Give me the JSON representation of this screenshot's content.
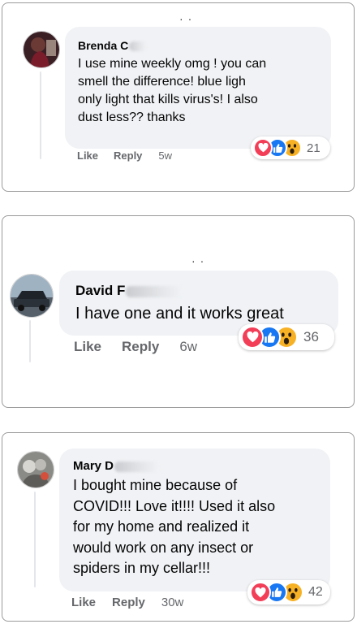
{
  "comments": [
    {
      "author_visible": "Brenda C",
      "text": "I use mine weekly omg ! you can smell the difference! blue ligh only light that kills virus's! I also dust less?? thanks",
      "text_lines": [
        "I use mine weekly omg ! you can",
        "smell the difference! blue ligh",
        "only light that kills virus's! I also",
        "dust less?? thanks"
      ],
      "like_label": "Like",
      "reply_label": "Reply",
      "time": "5w",
      "reaction_count": "21",
      "reaction_icons": [
        "love-icon",
        "like-icon",
        "wow-icon"
      ]
    },
    {
      "author_visible": "David F",
      "text": "I have one and it works great",
      "text_lines": [
        "I have one and it works great"
      ],
      "like_label": "Like",
      "reply_label": "Reply",
      "time": "6w",
      "reaction_count": "36",
      "reaction_icons": [
        "love-icon",
        "like-icon",
        "wow-icon"
      ]
    },
    {
      "author_visible": "Mary D",
      "text": "I bought mine because of COVID!!! Love it!!!! Used it also for my home and realized it would work on any insect or spiders in my cellar!!!",
      "text_lines": [
        "I bought mine because of",
        "COVID!!! Love it!!!! Used it also",
        "for my home and realized it",
        "would work on any insect or",
        "spiders in my cellar!!!"
      ],
      "like_label": "Like",
      "reply_label": "Reply",
      "time": "30w",
      "reaction_count": "42",
      "reaction_icons": [
        "love-icon",
        "like-icon",
        "wow-icon"
      ]
    }
  ],
  "colors": {
    "bubble_bg": "#f0f2f5",
    "text": "#050505",
    "muted": "#65676b",
    "love": "#f33e58",
    "like": "#1877f2",
    "wow": "#f7b125"
  }
}
